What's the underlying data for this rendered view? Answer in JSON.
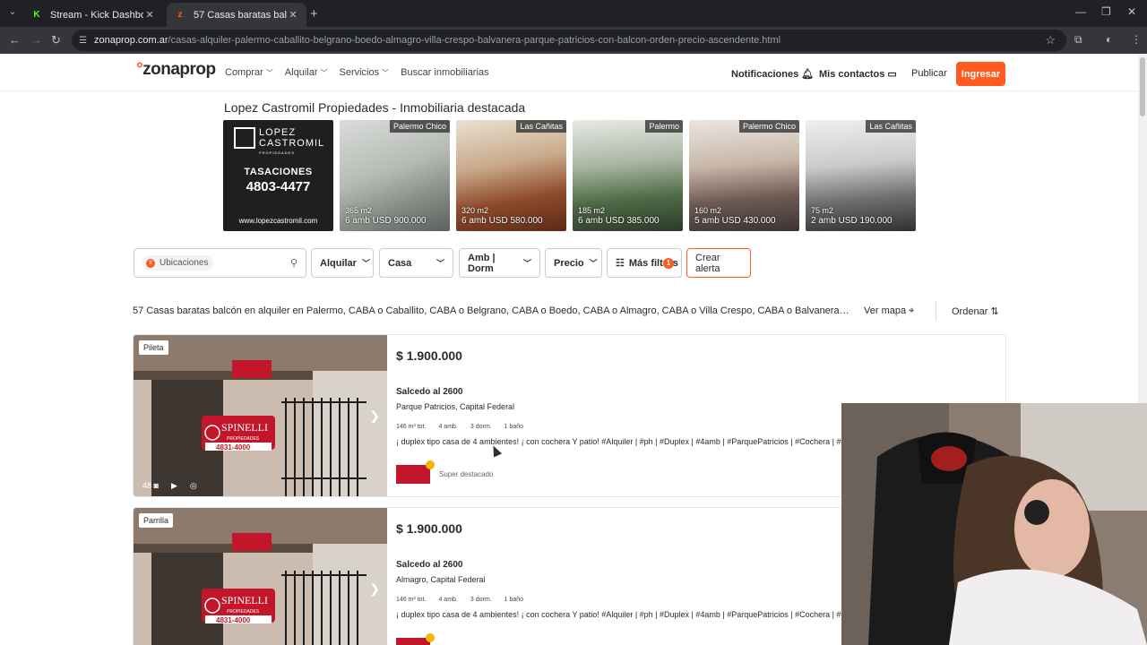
{
  "browser": {
    "tabs": [
      {
        "title": "Stream - Kick Dashboard",
        "favicon": "K",
        "favicon_color": "#53fc18",
        "active": false
      },
      {
        "title": "57 Casas baratas balcón en alquiler",
        "favicon": "z",
        "favicon_color": "#ff5a1f",
        "active": true
      }
    ],
    "url_domain": "zonaprop.com.ar",
    "url_path": "/casas-alquiler-palermo-caballito-belgrano-boedo-almagro-villa-crespo-balvanera-parque-patricios-con-balcon-orden-precio-ascendente.html"
  },
  "header": {
    "logo": "zonaprop",
    "nav": [
      "Comprar",
      "Alquilar",
      "Servicios",
      "Buscar inmobiliarias"
    ],
    "notifications": "Notificaciones",
    "contacts": "Mis contactos",
    "publish": "Publicar",
    "login": "Ingresar",
    "brand_color": "#ff5a1f"
  },
  "featured": {
    "title": "Lopez Castromil Propiedades - Inmobiliaria destacada",
    "logo_tile": {
      "name_line1": "LOPEZ",
      "name_line2": "CASTROMIL",
      "sub": "PROPIEDADES",
      "tagline": "TASACIONES",
      "phone": "4803-4477",
      "web": "www.lopezcastromil.com"
    },
    "properties": [
      {
        "badge": "Palermo Chico",
        "size": "365 m2",
        "rooms_price": "6 amb USD 900.000"
      },
      {
        "badge": "Las Cañitas",
        "size": "320 m2",
        "rooms_price": "6 amb USD 580.000"
      },
      {
        "badge": "Palermo",
        "size": "185 m2",
        "rooms_price": "6 amb USD 385.000"
      },
      {
        "badge": "Palermo Chico",
        "size": "160 m2",
        "rooms_price": "5 amb USD 430.000"
      },
      {
        "badge": "Las Cañitas",
        "size": "75 m2",
        "rooms_price": "2 amb USD 190.000"
      }
    ]
  },
  "filters": {
    "location_placeholder": "Ubicaciones",
    "operation": "Alquilar",
    "property_type": "Casa",
    "rooms": "Amb | Dorm",
    "price": "Precio",
    "more_filters": "Más filtros",
    "more_filters_count": "1",
    "create_alert": "Crear alerta"
  },
  "results": {
    "title": "57 Casas baratas balcón en alquiler en Palermo, CABA o Caballito, CABA o Belgrano, CABA o Boedo, CABA o Almagro, CABA o Villa Crespo, CABA o Balvanera, CABA o Parque Patricios, CABA",
    "map": "Ver mapa",
    "order": "Ordenar"
  },
  "listings": [
    {
      "tag": "Pileta",
      "photo_count": "48",
      "price": "$ 1.900.000",
      "address": "Salcedo al 2600",
      "location": "Parque Patricios, Capital Federal",
      "features": [
        "146 m² tot.",
        "4 amb.",
        "3 dorm.",
        "1 baño"
      ],
      "description": "¡ duplex tipo casa de 4 ambientes! ¡ con cochera Y patio! #Alquiler | #ph | #Duplex | #4amb | #ParquePatricios | #Cochera | #Patio",
      "tier": "Super destacado"
    },
    {
      "tag": "Parrilla",
      "photo_count": "48",
      "price": "$ 1.900.000",
      "address": "Salcedo al 2600",
      "location": "Almagro, Capital Federal",
      "features": [
        "146 m² tot.",
        "4 amb.",
        "3 dorm.",
        "1 baño"
      ],
      "description": "¡ duplex tipo casa de 4 ambientes! ¡ con cochera Y patio! #Alquiler | #ph | #Duplex | #4amb | #ParquePatricios | #Cochera | #Patio",
      "tier": "Super destacado"
    }
  ],
  "photo_sign": {
    "brand": "SPINELLI",
    "sub": "PROPIEDADES",
    "phone": "4831-4000",
    "sell": "VENDE"
  }
}
